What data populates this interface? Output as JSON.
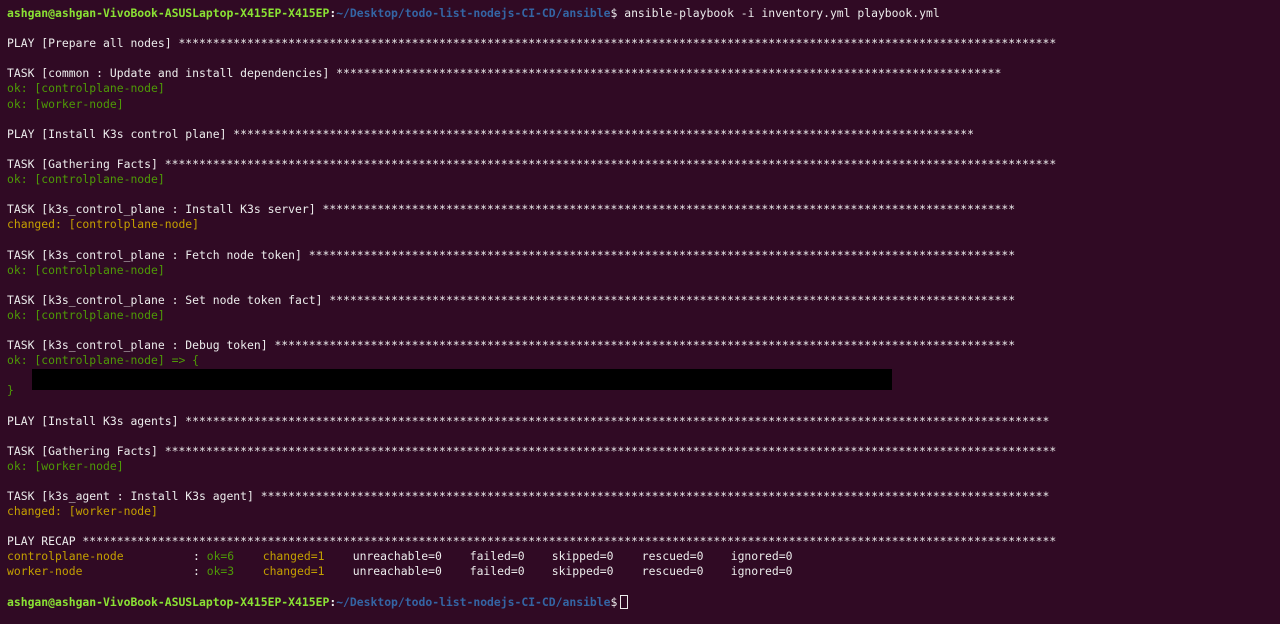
{
  "prompt": {
    "user_host": "ashgan@ashgan-VivoBook-ASUSLaptop-X415EP-X415EP",
    "separator": ":",
    "path": "~/Desktop/todo-list-nodejs-CI-CD/ansible",
    "symbol": "$"
  },
  "command": " ansible-playbook -i inventory.yml playbook.yml",
  "output": {
    "play1": "PLAY [Prepare all nodes] ********************************************************************************************************************************",
    "task1": "TASK [common : Update and install dependencies] *************************************************************************************************",
    "task1_ok1": "ok: [controlplane-node]",
    "task1_ok2": "ok: [worker-node]",
    "play2": "PLAY [Install K3s control plane] ************************************************************************************************************",
    "task2": "TASK [Gathering Facts] **********************************************************************************************************************************",
    "task2_ok": "ok: [controlplane-node]",
    "task3": "TASK [k3s_control_plane : Install K3s server] *****************************************************************************************************",
    "task3_changed": "changed: [controlplane-node]",
    "task4": "TASK [k3s_control_plane : Fetch node token] *******************************************************************************************************",
    "task4_ok": "ok: [controlplane-node]",
    "task5": "TASK [k3s_control_plane : Set node token fact] ****************************************************************************************************",
    "task5_ok": "ok: [controlplane-node]",
    "task6": "TASK [k3s_control_plane : Debug token] ************************************************************************************************************",
    "task6_ok": "ok: [controlplane-node] => {",
    "task6_close": "}",
    "play3": "PLAY [Install K3s agents] ******************************************************************************************************************************",
    "task7": "TASK [Gathering Facts] **********************************************************************************************************************************",
    "task7_ok": "ok: [worker-node]",
    "task8": "TASK [k3s_agent : Install K3s agent] *******************************************************************************************************************",
    "task8_changed": "changed: [worker-node]",
    "recap": "PLAY RECAP **********************************************************************************************************************************************"
  },
  "recap_rows": [
    {
      "host": "controlplane-node",
      "colon": ": ",
      "ok": "ok=6",
      "changed": "changed=1",
      "unreachable": "unreachable=0",
      "failed": "failed=0",
      "skipped": "skipped=0",
      "rescued": "rescued=0",
      "ignored": "ignored=0"
    },
    {
      "host": "worker-node",
      "colon": ": ",
      "ok": "ok=3",
      "changed": "changed=1",
      "unreachable": "unreachable=0",
      "failed": "failed=0",
      "skipped": "skipped=0",
      "rescued": "rescued=0",
      "ignored": "ignored=0"
    }
  ],
  "colors": {
    "background": "#300a24",
    "prompt_user": "#8ae234",
    "prompt_path": "#3465a4",
    "ok": "#4e9a06",
    "changed": "#c4a000",
    "text": "#ececec",
    "redaction": "#000000"
  }
}
